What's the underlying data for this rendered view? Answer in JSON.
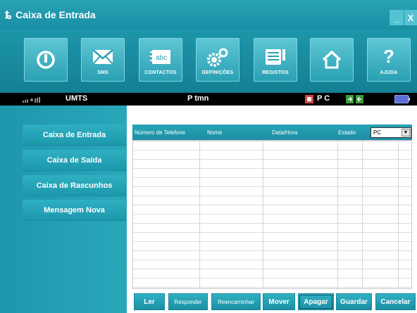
{
  "window": {
    "logo_glyph": "ȶ",
    "title": "Caixa de Entrada",
    "minimize_label": "_",
    "close_label": "X"
  },
  "toolbar": {
    "buttons": [
      {
        "icon": "power-icon",
        "label": ""
      },
      {
        "icon": "envelope-icon",
        "label": "SMS"
      },
      {
        "icon": "contacts-icon",
        "label": "CONTACTOS",
        "icon_text": "abc"
      },
      {
        "icon": "gears-icon",
        "label": "DEFINIÇÕES"
      },
      {
        "icon": "log-icon",
        "label": "REGISTOS"
      },
      {
        "icon": "home-icon",
        "label": ""
      },
      {
        "icon": "help-icon",
        "label": "AJUDA",
        "icon_text": "?"
      }
    ]
  },
  "statusbar": {
    "network": "UMTS",
    "operator": "P tmn",
    "pc_label": "P C"
  },
  "sidebar": {
    "items": [
      {
        "label": "Caixa de Entrada"
      },
      {
        "label": "Caixa de Saída"
      },
      {
        "label": "Caixa de Rascunhos"
      },
      {
        "label": "Mensagem Nova"
      }
    ]
  },
  "table": {
    "columns": [
      "Número de Telefone",
      "Nome",
      "Data/Hora",
      "Estado"
    ],
    "estado_value": "PC",
    "rows": []
  },
  "actions": {
    "read": "Ler",
    "reply": "Responder",
    "forward": "Reencaminhar",
    "move": "Mover",
    "delete": "Apagar",
    "save": "Guardar",
    "cancel": "Cancelar"
  },
  "colors": {
    "accent": "#1d96aa",
    "accent_light": "#2fb0c2"
  }
}
